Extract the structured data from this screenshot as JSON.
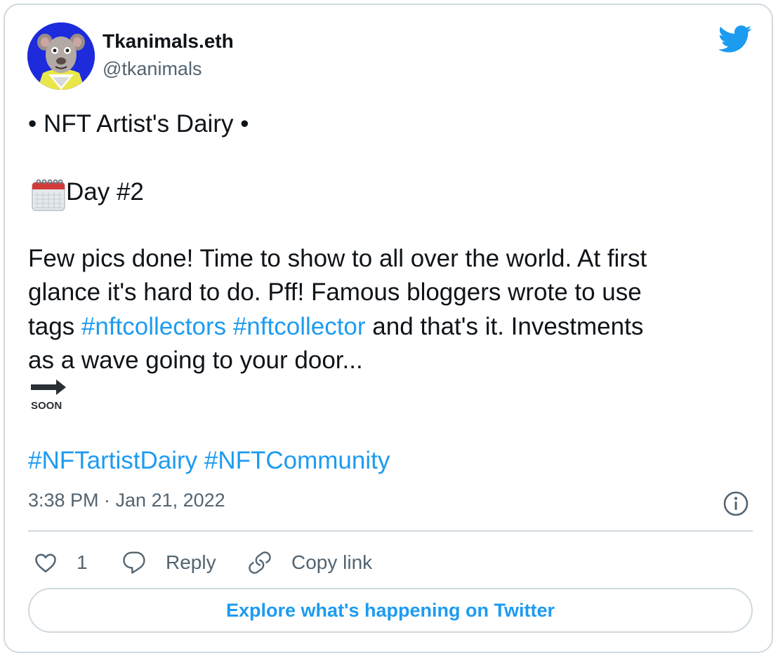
{
  "user": {
    "display_name": "Tkanimals.eth",
    "handle": "@tkanimals"
  },
  "tweet": {
    "title": "• NFT Artist's Dairy •",
    "day": "Day #2",
    "body_lines": [
      "Few pics done! Time to show to all over the world. At first",
      "glance it's hard to do. Pff! Famous bloggers wrote to use"
    ],
    "line3_prefix": "tags ",
    "hashtag_1": "#nftcollectors",
    "hashtag_2": "#nftcollector",
    "line3_suffix": " and that's it. Investments",
    "line4": "as a wave going to your door...",
    "soon_label": "SOON",
    "footer_tag_1": "#NFTartistDairy",
    "footer_tag_2": "#NFTCommunity",
    "timestamp": "3:38 PM · Jan 21, 2022"
  },
  "actions": {
    "like_count": "1",
    "reply_label": "Reply",
    "copy_link_label": "Copy link"
  },
  "explore_label": "Explore what's happening on Twitter",
  "colors": {
    "link": "#1d9bf0",
    "text": "#0f1419",
    "muted": "#536471",
    "border": "#cfd9de",
    "avatar_bg": "#1d2bdc"
  },
  "icons": [
    "twitter-bird-icon",
    "calendar-icon",
    "soon-arrow-icon",
    "info-icon",
    "heart-icon",
    "reply-icon",
    "link-icon"
  ]
}
